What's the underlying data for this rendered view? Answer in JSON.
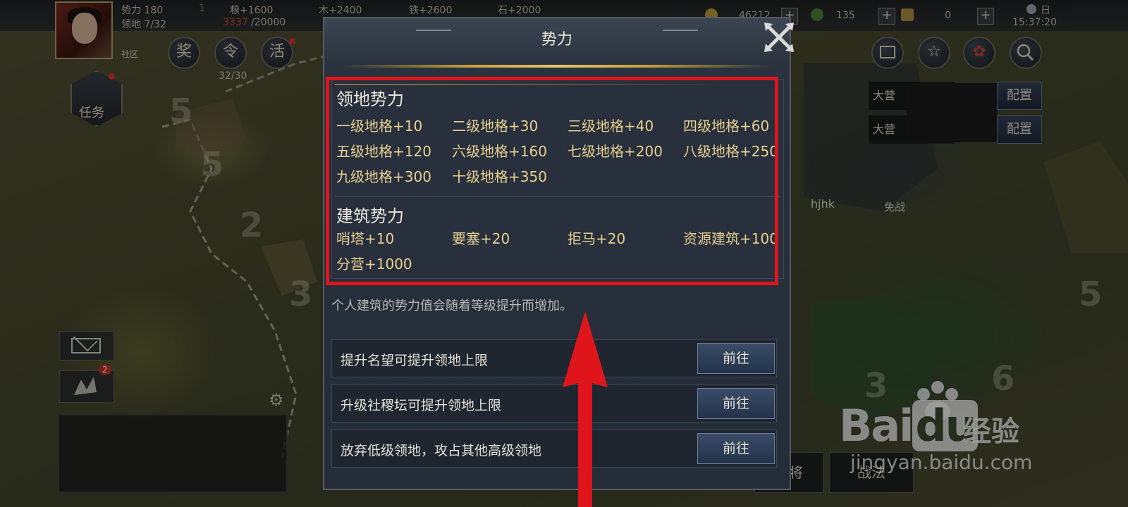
{
  "top_bar": {
    "power_label": "势力 180",
    "power_rank": "1",
    "territory_label": "领地 7/32",
    "grain": "粮+1600",
    "wood": "木+2400",
    "iron": "铁+2600",
    "stone": "石+2000",
    "storage_used": "3337",
    "storage_cap": "/20000",
    "copper": "46212",
    "jade": "135",
    "gold": "0",
    "weather": "日",
    "time": "15:37:20",
    "plus": "+"
  },
  "left_hud": {
    "social_label": "社区",
    "reward_btn": "奖",
    "order_btn": "令",
    "activity_btn": "活",
    "troop_count": "32/30",
    "task_label": "任务",
    "mail_badge": "2"
  },
  "right_hud": {
    "camp1": "大营",
    "camp2": "大营",
    "config1": "配置",
    "config2": "配置",
    "player_name": "hjhk",
    "truce": "免战",
    "tab_general": "武将",
    "tab_skill": "战法"
  },
  "map_numbers": [
    "5",
    "5",
    "2",
    "3",
    "5",
    "3",
    "6"
  ],
  "dialog": {
    "title": "势力",
    "territory_section": {
      "title": "领地势力",
      "items": [
        "一级地格+10",
        "二级地格+30",
        "三级地格+40",
        "四级地格+60",
        "五级地格+120",
        "六级地格+160",
        "七级地格+200",
        "八级地格+250",
        "九级地格+300",
        "十级地格+350"
      ]
    },
    "building_section": {
      "title": "建筑势力",
      "items": [
        "哨塔+10",
        "要塞+20",
        "拒马+20",
        "资源建筑+100",
        "分营+1000"
      ]
    },
    "note": "个人建筑的势力值会随着等级提升而增加。",
    "tips": [
      {
        "text": "提升名望可提升领地上限",
        "button": "前往"
      },
      {
        "text": "升级社稷坛可提升领地上限",
        "button": "前往"
      },
      {
        "text": "放弃低级领地，攻占其他高级领地",
        "button": "前往"
      }
    ]
  },
  "watermark": {
    "logo": "Bai",
    "logo_du": "du",
    "sub": "经验",
    "url": "jingyan.baidu.com"
  },
  "colors": {
    "highlight": "#e0141b",
    "gold_text": "#e7cf8f",
    "dialog_bg": "#26303c"
  }
}
